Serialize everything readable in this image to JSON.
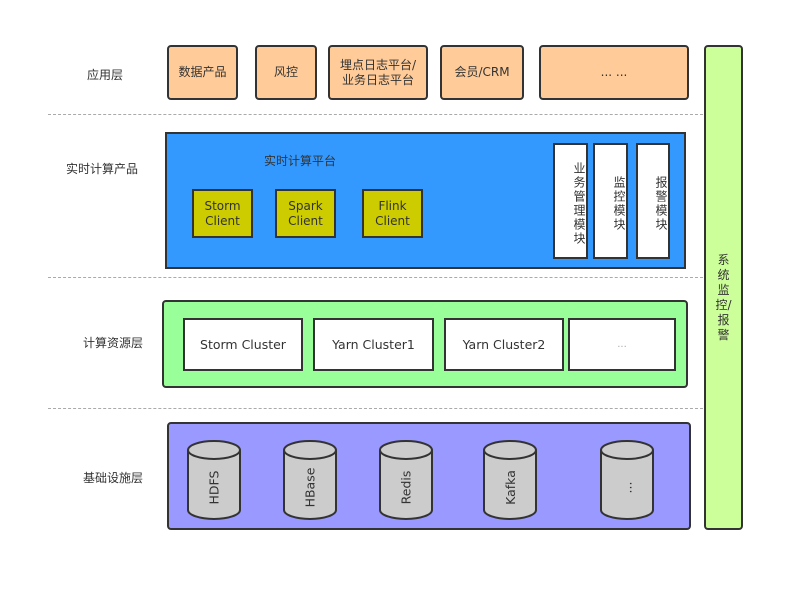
{
  "layers": {
    "application": {
      "label": "应用层",
      "items": [
        "数据产品",
        "风控",
        "埋点日志平台/\n业务日志平台",
        "会员/CRM",
        "... ..."
      ]
    },
    "realtime": {
      "label": "实时计算产品",
      "platform_title": "实时计算平台",
      "clients": [
        "Storm\nClient",
        "Spark\nClient",
        "Flink\nClient"
      ],
      "modules": [
        "业务管理模块",
        "监控模块",
        "报警模块"
      ]
    },
    "compute": {
      "label": "计算资源层",
      "clusters": [
        "Storm Cluster",
        "Yarn Cluster1",
        "Yarn Cluster2",
        "..."
      ]
    },
    "infra": {
      "label": "基础设施层",
      "stores": [
        "HDFS",
        "HBase",
        "Redis",
        "Kafka",
        "..."
      ]
    }
  },
  "sidebar": {
    "label": "系统监控/报警"
  },
  "colors": {
    "application": "#ffcc99",
    "platform": "#3399ff",
    "client": "#cccc00",
    "compute": "#99ff99",
    "infra": "#9999ff",
    "sidebar": "#ccff99",
    "cylinder": "#cccccc"
  }
}
